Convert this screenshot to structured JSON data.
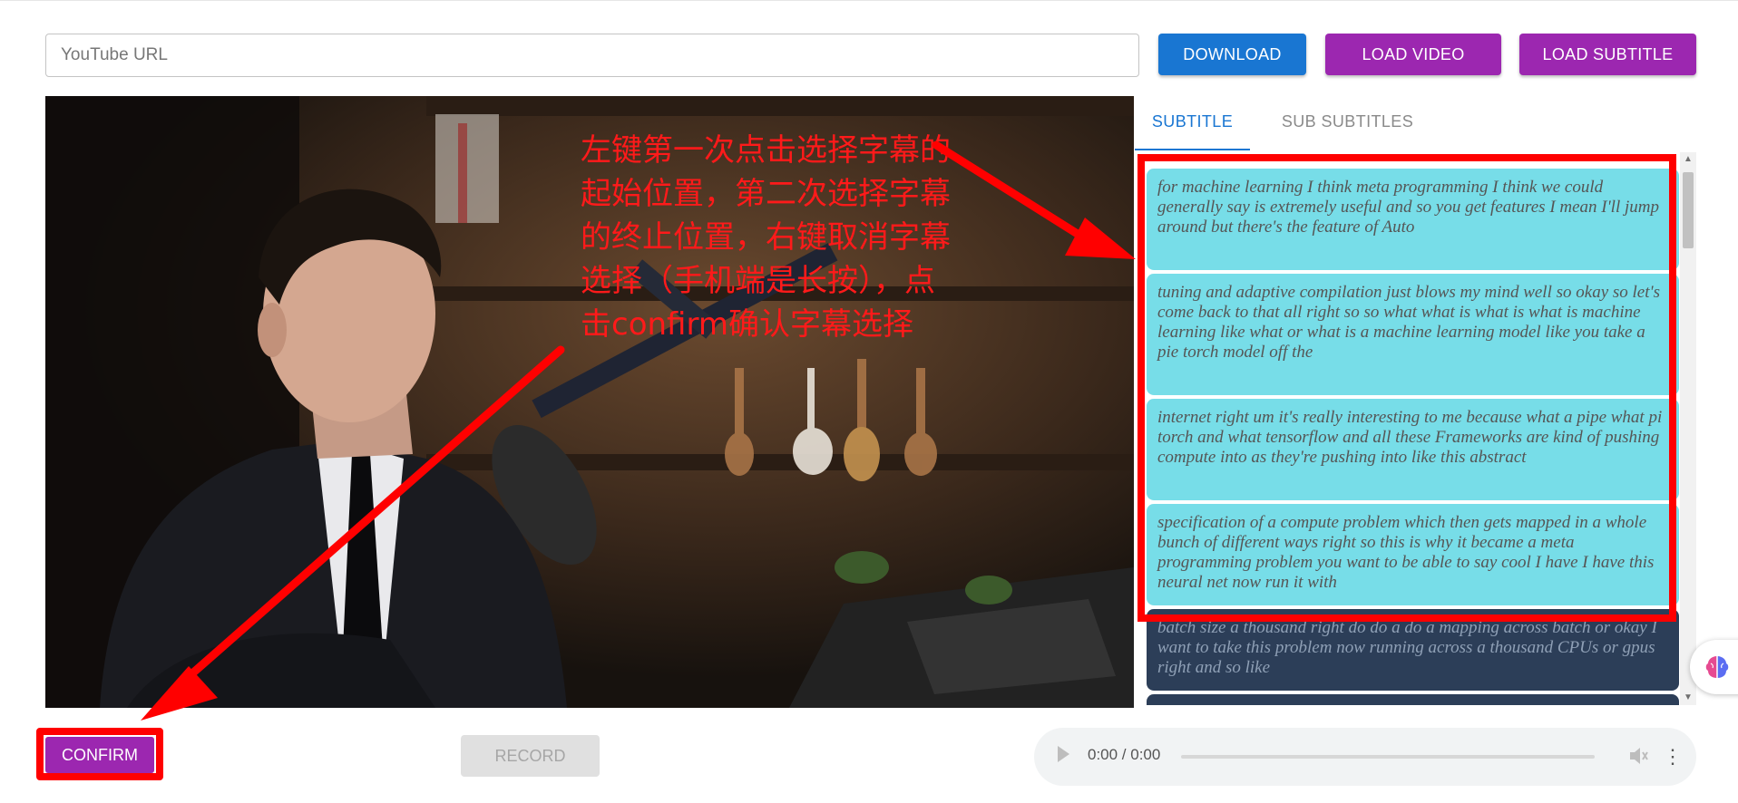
{
  "toolbar": {
    "url_placeholder": "YouTube URL",
    "download_label": "DOWNLOAD",
    "load_video_label": "LOAD VIDEO",
    "load_subtitle_label": "LOAD SUBTITLE"
  },
  "annotation": {
    "text": "左键第一次点击选择字幕的起始位置，第二次选择字幕的终止位置，右键取消字幕选择（手机端是长按），点击confirm确认字幕选择"
  },
  "tabs": [
    {
      "label": "SUBTITLE",
      "active": true
    },
    {
      "label": "SUB SUBTITLES",
      "active": false
    }
  ],
  "subtitles": [
    {
      "text": "for machine learning I think meta programming I think we could generally say is extremely useful and so you get features I mean I'll jump around but there's the feature of Auto",
      "selected": true
    },
    {
      "text": "tuning and adaptive compilation just blows my mind well so okay so let's come back to that all right so so what what is what is what is machine learning like what or what is a machine learning model like you take a pie torch model off the",
      "selected": true
    },
    {
      "text": "internet right um it's really interesting to me because what a pipe what pi torch and what tensorflow and all these Frameworks are kind of pushing compute into as they're pushing into like this abstract",
      "selected": true
    },
    {
      "text": "specification of a compute problem which then gets mapped in a whole bunch of different ways right so this is why it became a meta programming problem you want to be able to say cool I have I have this neural net now run it with",
      "selected": true
    },
    {
      "text": "batch size a thousand right do do a do a mapping across batch or okay I want to take this problem now running across a thousand CPUs or gpus right and so like",
      "selected": false
    }
  ],
  "bottom": {
    "confirm_label": "CONFIRM",
    "record_label": "RECORD"
  },
  "audio": {
    "time": "0:00 / 0:00",
    "progress": 0
  },
  "colors": {
    "primary": "#1976d2",
    "secondary": "#9c27b0",
    "selected_card": "#77dde8",
    "unselected_card": "#2c3e58",
    "annotation": "#ff0000"
  }
}
